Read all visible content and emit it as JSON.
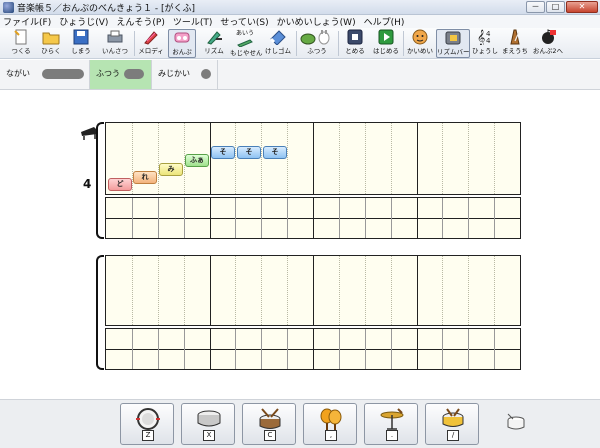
{
  "window": {
    "title": "音楽帳５／おんぷのべんきょう１ - [がくふ]",
    "controls": {
      "minimize": "－",
      "maximize": "□",
      "close": "✕"
    }
  },
  "menu": [
    "ファイル(F)",
    "ひょうじ(V)",
    "えんそう(P)",
    "ツール(T)",
    "せってい(S)",
    "かいめいしょう(W)",
    "ヘルプ(H)"
  ],
  "toolbar": {
    "tools": [
      {
        "label": "つくる",
        "icon": "new-file-icon"
      },
      {
        "label": "ひらく",
        "icon": "folder-open-icon"
      },
      {
        "label": "しまう",
        "icon": "save-disk-icon"
      },
      {
        "label": "いんさつ",
        "icon": "printer-icon"
      },
      {
        "label": "メロディ",
        "icon": "melody-pencil-icon"
      },
      {
        "label": "おんぷ",
        "icon": "note-eraser-icon"
      },
      {
        "label": "リズム",
        "icon": "rhythm-tool-icon"
      },
      {
        "label": "もじやせん",
        "icon": "text-line-icon",
        "badge": "あいう"
      },
      {
        "label": "けしゴム",
        "icon": "eraser-icon"
      },
      {
        "label": "ふつう",
        "icon": "turtle-rabbit-speed-icon"
      },
      {
        "label": "とめる",
        "icon": "stop-icon"
      },
      {
        "label": "はじめる",
        "icon": "play-icon"
      },
      {
        "label": "かいめい",
        "icon": "solfege-face-icon"
      },
      {
        "label": "リズムバー",
        "icon": "rhythm-bar-icon"
      },
      {
        "label": "ひょうし",
        "icon": "time-signature-icon"
      },
      {
        "label": "まえうち",
        "icon": "metronome-icon"
      },
      {
        "label": "おんぷ2へ",
        "icon": "next-lesson-icon"
      }
    ]
  },
  "tempo": {
    "options": [
      "ながい",
      "ふつう",
      "みじかい"
    ],
    "selected": "ふつう"
  },
  "score": {
    "time_signature": "4",
    "notes": [
      {
        "label": "ど",
        "pitch": "do"
      },
      {
        "label": "れ",
        "pitch": "re"
      },
      {
        "label": "み",
        "pitch": "mi"
      },
      {
        "label": "ふぁ",
        "pitch": "fa"
      },
      {
        "label": "そ",
        "pitch": "so"
      },
      {
        "label": "そ",
        "pitch": "so"
      },
      {
        "label": "そ",
        "pitch": "so"
      }
    ]
  },
  "instruments": [
    {
      "key": "Z",
      "icon": "bass-drum-icon"
    },
    {
      "key": "X",
      "icon": "snare-drum-icon"
    },
    {
      "key": "C",
      "icon": "tom-drum-sticks-icon"
    },
    {
      "key": ",",
      "icon": "maracas-icon"
    },
    {
      "key": ".",
      "icon": "cymbal-icon"
    },
    {
      "key": "/",
      "icon": "tambourine-drum-icon"
    }
  ]
}
